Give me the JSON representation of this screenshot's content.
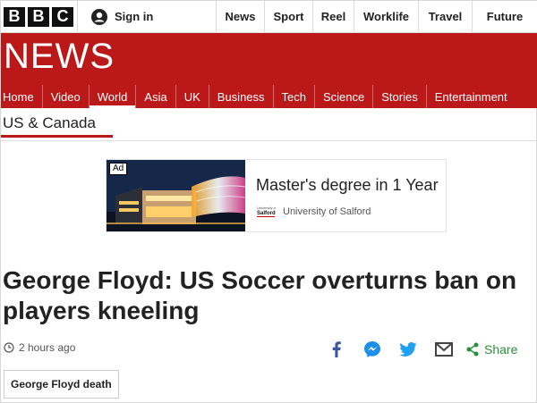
{
  "header": {
    "logo_letters": [
      "B",
      "B",
      "C"
    ],
    "signin_label": "Sign in",
    "nav": [
      "News",
      "Sport",
      "Reel",
      "Worklife",
      "Travel",
      "Future"
    ]
  },
  "banner": {
    "brand": "NEWS",
    "color": "#bb1919"
  },
  "section_nav": {
    "items": [
      "Home",
      "Video",
      "World",
      "Asia",
      "UK",
      "Business",
      "Tech",
      "Science",
      "Stories",
      "Entertainment"
    ],
    "active": "World"
  },
  "subsection": {
    "label": "US & Canada"
  },
  "ad": {
    "badge": "Ad",
    "title": "Master's degree in 1 Year",
    "sponsor": "University of Salford",
    "logo_text": "University of Salford"
  },
  "article": {
    "headline": "George Floyd: US Soccer overturns ban on players kneeling",
    "timestamp": "2 hours ago",
    "share_label": "Share",
    "tag": "George Floyd death"
  }
}
